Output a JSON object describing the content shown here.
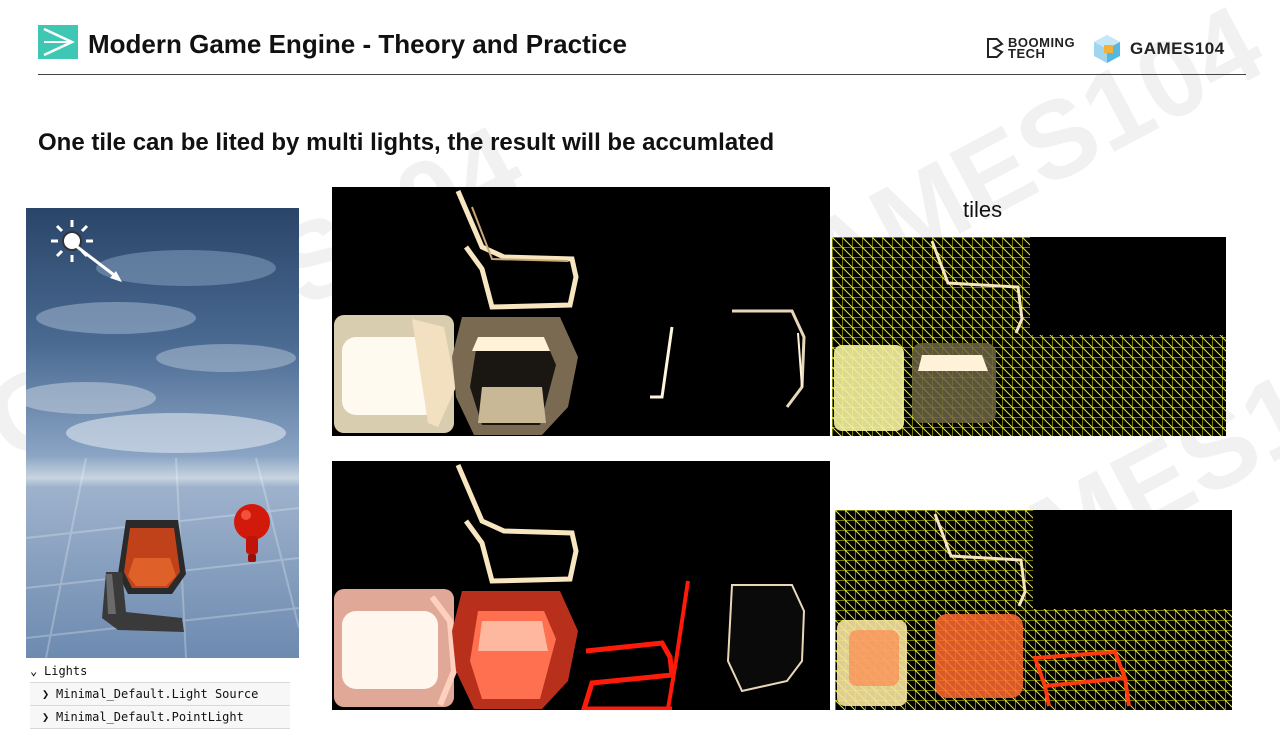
{
  "header": {
    "title": "Modern Game Engine - Theory and Practice",
    "brand_booming_line1": "BOOMING",
    "brand_booming_line2": "TECH",
    "brand_games": "GAMES104",
    "accent_color": "#3ec8b4"
  },
  "slide": {
    "subtitle": "One tile can be lited by multi lights, the result will be accumlated",
    "tiles_label": "tiles"
  },
  "outliner": {
    "group_label": "Lights",
    "items": [
      {
        "label": "Minimal_Default.Light Source"
      },
      {
        "label": "Minimal_Default.PointLight"
      }
    ]
  },
  "watermark": "GAMES104",
  "colors": {
    "tile_grid": "#e8f000",
    "highlight": "#fff6dc",
    "point_light": "#ff2a10",
    "panel_bg": "#000000"
  }
}
